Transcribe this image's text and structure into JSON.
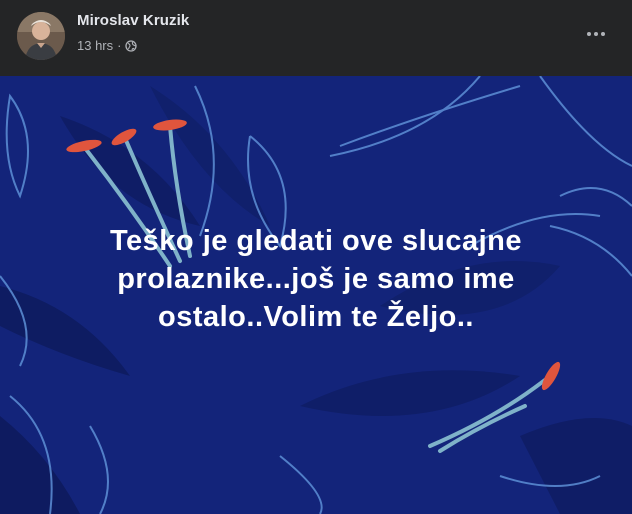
{
  "author": {
    "name": "Miroslav Kruzik",
    "avatar_icon": "profile-photo"
  },
  "meta": {
    "time": "13 hrs",
    "separator": "·",
    "audience_icon": "globe-icon"
  },
  "actions": {
    "more_icon": "more-horizontal-icon"
  },
  "post": {
    "background_color": "#13247a",
    "text_color": "#ffffff",
    "lines": [
      "Teško je gledati ove slucajne",
      "prolaznike...još je samo ime",
      "ostalo..Volim te Željo.."
    ]
  }
}
